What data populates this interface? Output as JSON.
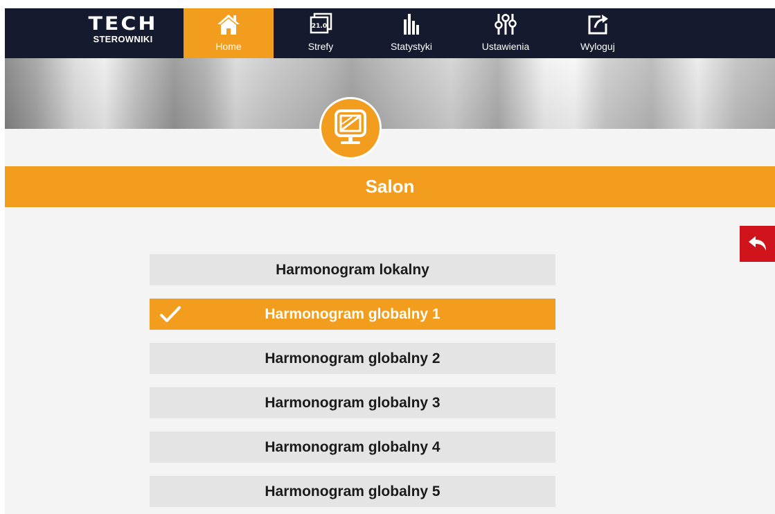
{
  "navbar": {
    "logo": {
      "mark": "TECH",
      "sub": "STEROWNIKI"
    },
    "items": [
      {
        "label": "Home",
        "icon": "home-icon",
        "active": true
      },
      {
        "label": "Strefy",
        "icon": "zones-thermostat-icon",
        "badge": "21.0"
      },
      {
        "label": "Statystyki",
        "icon": "statistics-bars-icon"
      },
      {
        "label": "Ustawienia",
        "icon": "settings-sliders-icon"
      },
      {
        "label": "Wyloguj",
        "icon": "logout-arrow-icon"
      }
    ]
  },
  "zone": {
    "icon": "screen-monitor-icon",
    "title": "Salon"
  },
  "back_button": {
    "icon": "back-arrow-icon"
  },
  "schedules": [
    {
      "label": "Harmonogram lokalny",
      "selected": false
    },
    {
      "label": "Harmonogram globalny 1",
      "selected": true
    },
    {
      "label": "Harmonogram globalny 2",
      "selected": false
    },
    {
      "label": "Harmonogram globalny 3",
      "selected": false
    },
    {
      "label": "Harmonogram globalny 4",
      "selected": false
    },
    {
      "label": "Harmonogram globalny 5",
      "selected": false
    }
  ],
  "colors": {
    "accent": "#f29d1d",
    "navbar": "#151a2e",
    "back_button": "#d0141c",
    "item_background": "#e4e4e4"
  }
}
